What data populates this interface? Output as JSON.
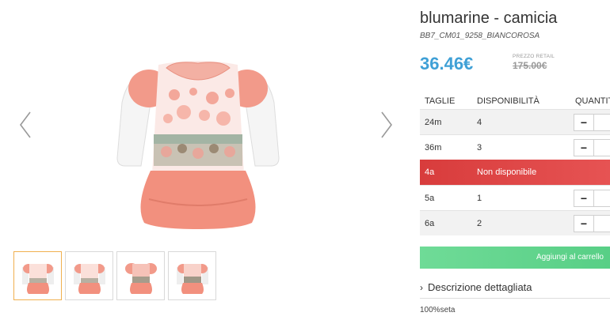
{
  "product": {
    "title": "blumarine - camicia",
    "sku": "BB7_CM01_9258_BIANCOROSA",
    "price": "36.46€",
    "retail_label": "PREZZO RETAIL",
    "retail_price": "175.00€"
  },
  "sizes_table": {
    "headers": [
      "TAGLIE",
      "DISPONIBILITÀ",
      "QUANTIT"
    ],
    "rows": [
      {
        "size": "24m",
        "availability": "4"
      },
      {
        "size": "36m",
        "availability": "3"
      },
      {
        "size": "4a",
        "availability": "Non disponibile"
      },
      {
        "size": "5a",
        "availability": "1"
      },
      {
        "size": "6a",
        "availability": "2"
      }
    ],
    "minus_symbol": "−"
  },
  "actions": {
    "add_to_cart": "Aggiungi al carrello"
  },
  "description": {
    "toggle_label": "Descrizione dettagliata",
    "chevron": "›",
    "text": "100%seta"
  },
  "gallery": {
    "thumbnail_count": 4,
    "active_thumbnail": 1,
    "icons": [
      "chevron-left-icon",
      "chevron-right-icon"
    ]
  },
  "colors": {
    "price": "#3fa0d6",
    "unavailable_row": "#d83c3c",
    "add_to_cart": "#6fdb97",
    "active_thumb_border": "#f0b04f"
  }
}
